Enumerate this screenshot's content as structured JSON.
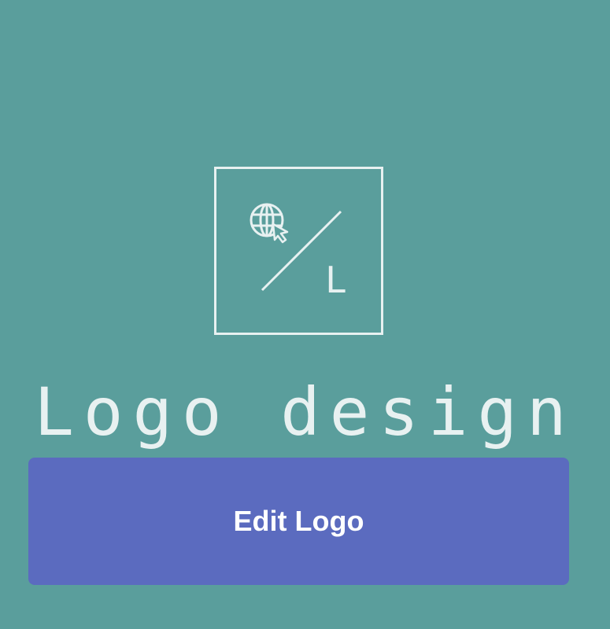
{
  "logo": {
    "letter": "L",
    "text": "Logo design",
    "icon": "globe-cursor-icon"
  },
  "actions": {
    "edit_label": "Edit Logo"
  },
  "colors": {
    "background": "#5a9e9c",
    "foreground": "#e8f1f1",
    "button": "#5b6bbf"
  }
}
